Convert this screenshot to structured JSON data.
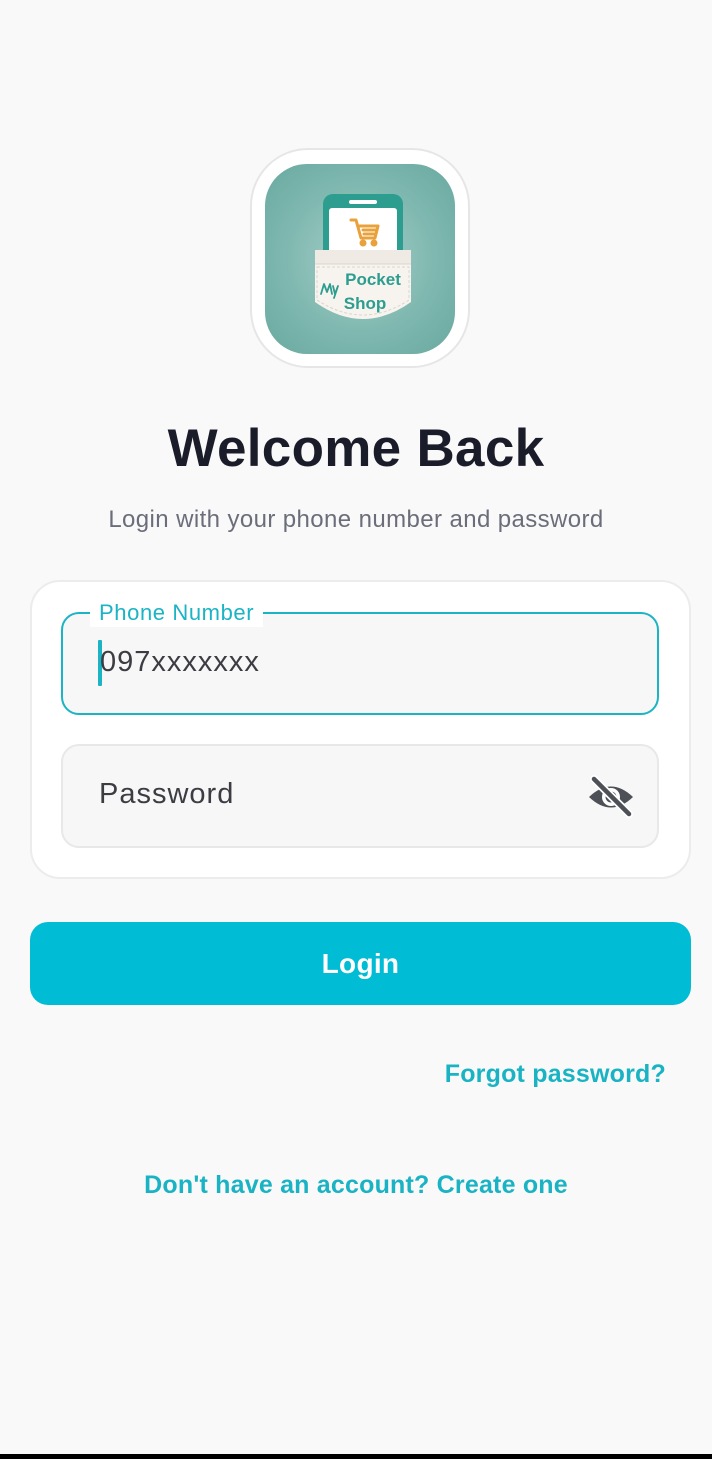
{
  "logo": {
    "line1": "Pocket",
    "line2": "Shop",
    "prefix": "My",
    "tile_color": "#7fb8b0",
    "phone_color": "#2d9d8f",
    "cart_color": "#e9a13b",
    "icon": "pocket-shop-logo-icon"
  },
  "header": {
    "title": "Welcome Back",
    "subtitle": "Login with your phone number and password"
  },
  "form": {
    "phone": {
      "label": "Phone Number",
      "value": "097xxxxxxx"
    },
    "password": {
      "placeholder": "Password",
      "toggle_icon": "eye-off-icon"
    }
  },
  "actions": {
    "login_label": "Login",
    "forgot_label": "Forgot password?",
    "signup_label": "Don't have an account? Create one"
  },
  "colors": {
    "accent": "#00bcd4",
    "link": "#19b3c4",
    "title": "#1b1c2a",
    "subtitle": "#6b6e7a"
  }
}
